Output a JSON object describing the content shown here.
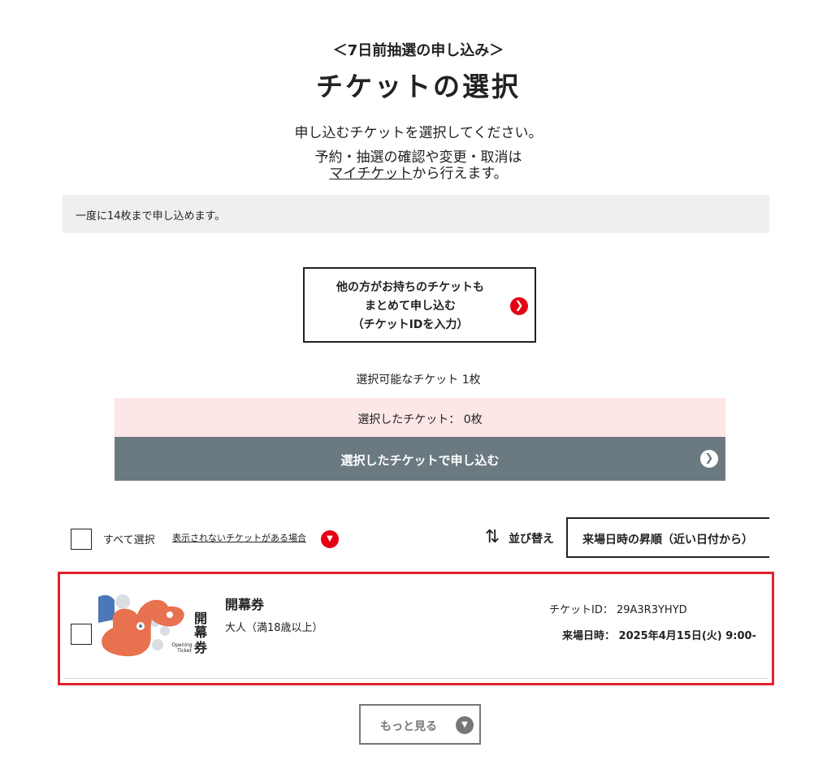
{
  "header": {
    "subtitle": "＜7日前抽選の申し込み＞",
    "title": "チケットの選択",
    "instruction": "申し込むチケットを選択してください。",
    "note_line1": "予約・抽選の確認や変更・取消は",
    "note_link": "マイチケット",
    "note_suffix": "から行えます。"
  },
  "limit_text": "一度に14枚まで申し込めます。",
  "other_ticket_button": {
    "line1": "他の方がお持ちのチケットも",
    "line2": "まとめて申し込む",
    "line3": "（チケットIDを入力）",
    "icon": "chevron-right-icon"
  },
  "summary": {
    "available": "選択可能なチケット 1枚",
    "selected": "選択したチケット： 0枚",
    "apply_button": "選択したチケットで申し込む"
  },
  "list_controls": {
    "select_all_label": "すべて選択",
    "hidden_tickets_link": "表示されないチケットがある場合",
    "sort_label": "並び替え",
    "sort_value": "来場日時の昇順（近い日付から）"
  },
  "tickets": [
    {
      "name": "開幕券",
      "type": "大人（満18歳以上）",
      "ticket_id": "チケットID： 29A3R3YHYD",
      "visit_date": "来場日時： 2025年4月15日(火) 9:00-",
      "thumbnail": {
        "vertical_label": "開幕券",
        "sub_label_1": "Opening",
        "sub_label_2": "Ticket"
      }
    }
  ],
  "more_button": "もっと見る",
  "colors": {
    "accent_red": "#e60012",
    "apply_gray": "#6b7a80",
    "selected_pink": "#fce6e6",
    "highlight_frame": "#e3212d"
  }
}
